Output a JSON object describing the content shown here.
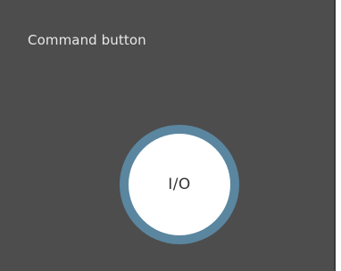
{
  "widget": {
    "title": "Command button",
    "button": {
      "label": "I/O"
    }
  },
  "colors": {
    "panel_background": "#4d4d4d",
    "title_text": "#e8e8e8",
    "button_ring": "#5b86a0",
    "button_face": "#ffffff",
    "button_text": "#333333"
  }
}
